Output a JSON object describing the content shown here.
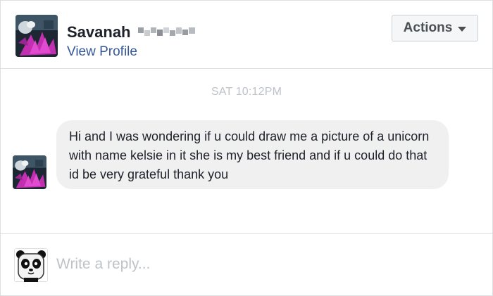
{
  "header": {
    "contact_name": "Savanah",
    "view_profile_label": "View Profile",
    "actions_label": "Actions"
  },
  "conversation": {
    "timestamp": "SAT 10:12PM",
    "message_text": "Hi and I was wondering if u could draw me a picture of a unicorn with name kelsie in it she is my best friend and if u could do that id be very grateful thank you"
  },
  "composer": {
    "placeholder": "Write a reply..."
  },
  "colors": {
    "link": "#365899",
    "bubble_bg": "#f1f0f0",
    "timestamp": "#bec3c9",
    "border": "#dddfe2"
  },
  "icons": {
    "actions_caret": "chevron-down-icon"
  }
}
